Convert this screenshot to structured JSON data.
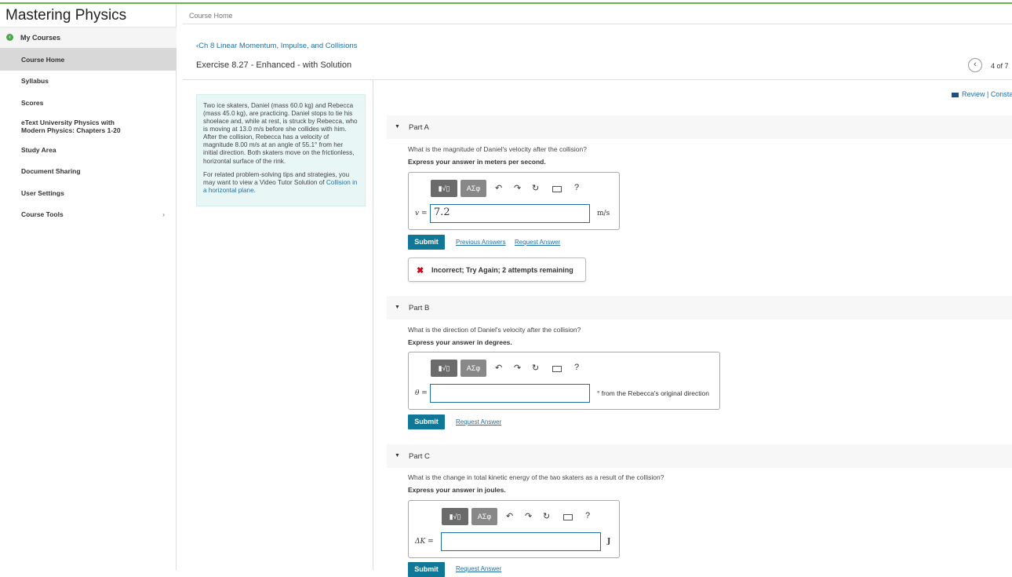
{
  "app": {
    "brand": "Mastering Physics",
    "breadcrumb_top": "Course Home",
    "chapter_link": "Ch 8 Linear Momentum, Impulse, and Collisions",
    "exercise_title": "Exercise 8.27 - Enhanced - with Solution",
    "page_counter": "4 of 7",
    "review_link": "Review | Consta"
  },
  "sidebar": {
    "my_courses": "My Courses",
    "items": [
      {
        "label": "Course Home",
        "active": true
      },
      {
        "label": "Syllabus"
      },
      {
        "label": "Scores"
      },
      {
        "label": "eText University Physics with",
        "label2": "Modern Physics: Chapters 1-20"
      },
      {
        "label": "Study Area"
      },
      {
        "label": "Document Sharing"
      },
      {
        "label": "User Settings"
      },
      {
        "label": "Course Tools"
      }
    ]
  },
  "problem": {
    "text": "Two ice skaters, Daniel (mass 60.0 kg) and Rebecca (mass 45.0 kg), are practicing. Daniel stops to tie his shoelace and, while at rest, is struck by Rebecca, who is moving at 13.0 m/s before she collides with him. After the collision, Rebecca has a velocity of magnitude 8.00 m/s at an angle of 55.1° from her initial direction. Both skaters move on the frictionless, horizontal surface of the rink.",
    "tips": "For related problem-solving tips and strategies, you may want to view a Video Tutor Solution of ",
    "tips_link": "Collision in a horizontal plane",
    "tips_end": "."
  },
  "toolbar": {
    "templates": "▮√▯",
    "greek": "ΑΣφ",
    "undo": "↶",
    "redo": "↷",
    "reset": "↻",
    "help": "?"
  },
  "parts": {
    "a": {
      "title": "Part A",
      "question": "What is the magnitude of Daniel's velocity after the collision?",
      "express": "Express your answer in meters per second.",
      "var": "v =",
      "value": "7.2",
      "unit": "m/s",
      "submit": "Submit",
      "previous": "Previous Answers",
      "request": "Request Answer",
      "feedback": "Incorrect; Try Again; 2 attempts remaining"
    },
    "b": {
      "title": "Part B",
      "question": "What is the direction of Daniel's velocity after the collision?",
      "express": "Express your answer in degrees.",
      "var": "θ =",
      "value": "",
      "unit": "° from the Rebecca's original direction",
      "submit": "Submit",
      "request": "Request Answer"
    },
    "c": {
      "title": "Part C",
      "question": "What is the change in total kinetic energy of the two skaters as a result of the collision?",
      "express": "Express your answer in joules.",
      "var": "ΔK =",
      "value": "",
      "unit": "J",
      "submit": "Submit",
      "request": "Request Answer"
    }
  },
  "colors": {
    "accent": "#107896",
    "link": "#1f6fa3",
    "top_bar": "#6db33f",
    "error": "#d0021b"
  }
}
